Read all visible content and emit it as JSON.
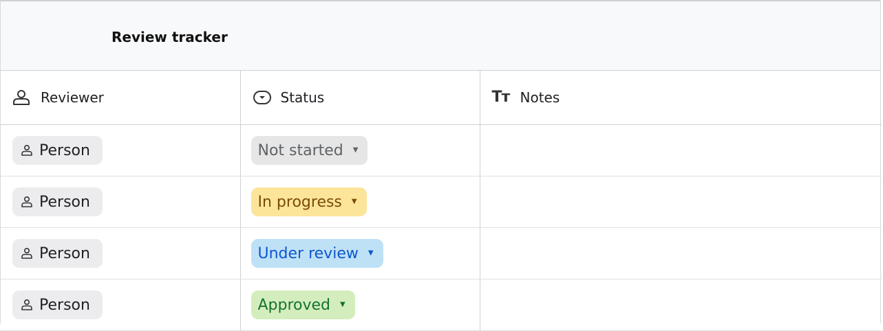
{
  "title": "Review tracker",
  "columns": [
    {
      "label": "Reviewer",
      "icon": "person-icon"
    },
    {
      "label": "Status",
      "icon": "dropdown-chip-icon"
    },
    {
      "label": "Notes",
      "icon": "text-format-icon",
      "icon_text": "Tт"
    }
  ],
  "rows": [
    {
      "reviewer": "Person",
      "status": "Not started",
      "status_color": "#e6e6e6",
      "notes": ""
    },
    {
      "reviewer": "Person",
      "status": "In progress",
      "status_color": "#fde49b",
      "notes": ""
    },
    {
      "reviewer": "Person",
      "status": "Under review",
      "status_color": "#bfe1f6",
      "notes": ""
    },
    {
      "reviewer": "Person",
      "status": "Approved",
      "status_color": "#d4edbc",
      "notes": ""
    }
  ]
}
